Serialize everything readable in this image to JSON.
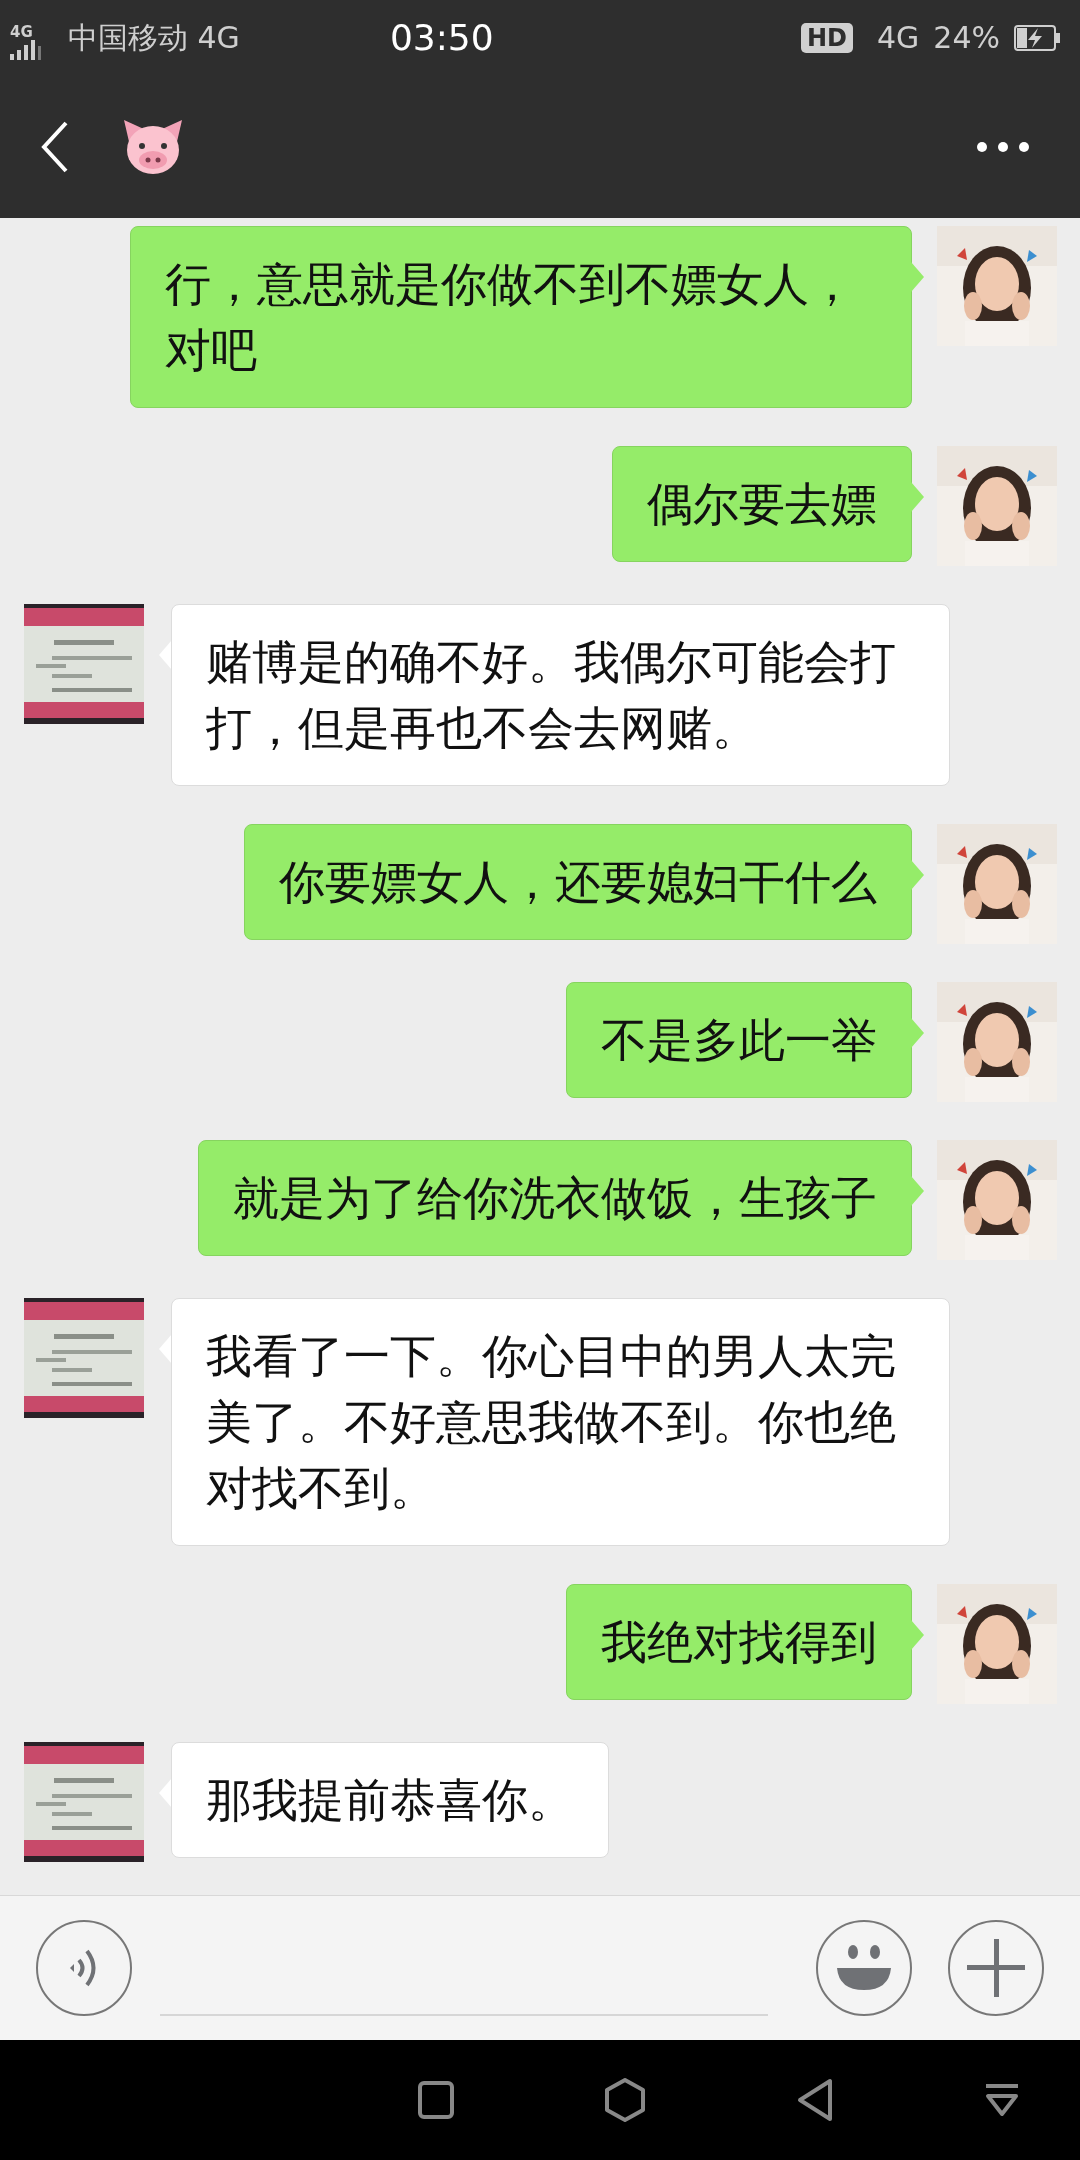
{
  "status_bar": {
    "signal_label": "4G",
    "carrier": "中国移动 4G",
    "time": "03:50",
    "hd_badge": "HD",
    "network": "4G",
    "battery": "24%"
  },
  "messages": [
    {
      "kind": "sent",
      "text": "行，意思就是你做不到不嫖女人，对吧"
    },
    {
      "kind": "sent",
      "text": "偶尔要去嫖"
    },
    {
      "kind": "received",
      "text": "赌博是的确不好。我偶尔可能会打打，但是再也不会去网赌。"
    },
    {
      "kind": "sent",
      "text": "你要嫖女人，还要媳妇干什么"
    },
    {
      "kind": "sent",
      "text": "不是多此一举"
    },
    {
      "kind": "sent",
      "text": "就是为了给你洗衣做饭，生孩子"
    },
    {
      "kind": "received",
      "text": "我看了一下。你心目中的男人太完美了。不好意思我做不到。你也绝对找不到。"
    },
    {
      "kind": "sent",
      "text": "我绝对找得到"
    },
    {
      "kind": "received",
      "text": "那我提前恭喜你。"
    }
  ]
}
